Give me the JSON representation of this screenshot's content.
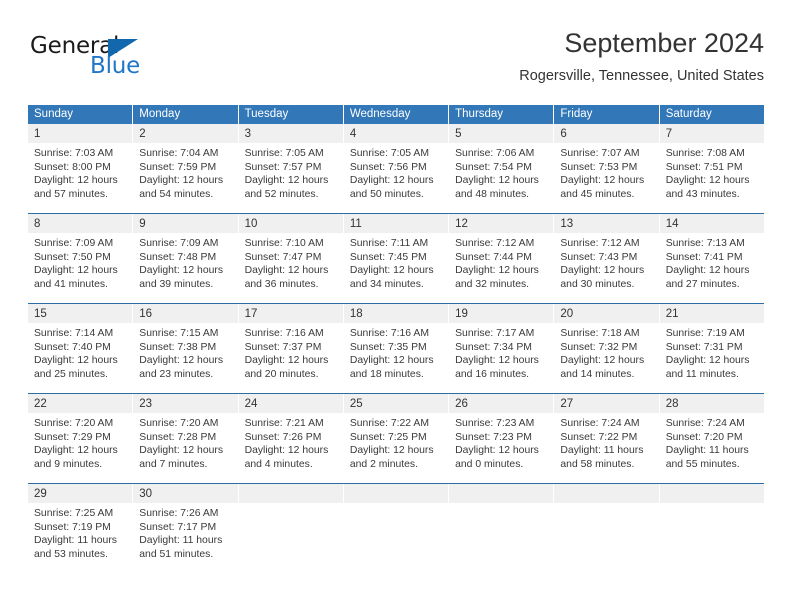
{
  "logo": {
    "word_top": "General",
    "word_bottom": "Blue",
    "accent_color": "#1267ad",
    "blue_text_color": "#2176c7"
  },
  "header": {
    "title": "September 2024",
    "subtitle": "Rogersville, Tennessee, United States",
    "header_bg_color": "#3277b8",
    "row_border_color": "#2e6da4",
    "daynum_bg_color": "#f0f0f0"
  },
  "weekdays": [
    "Sunday",
    "Monday",
    "Tuesday",
    "Wednesday",
    "Thursday",
    "Friday",
    "Saturday"
  ],
  "weeks": [
    [
      {
        "day": "1",
        "l1": "Sunrise: 7:03 AM",
        "l2": "Sunset: 8:00 PM",
        "l3": "Daylight: 12 hours",
        "l4": "and 57 minutes."
      },
      {
        "day": "2",
        "l1": "Sunrise: 7:04 AM",
        "l2": "Sunset: 7:59 PM",
        "l3": "Daylight: 12 hours",
        "l4": "and 54 minutes."
      },
      {
        "day": "3",
        "l1": "Sunrise: 7:05 AM",
        "l2": "Sunset: 7:57 PM",
        "l3": "Daylight: 12 hours",
        "l4": "and 52 minutes."
      },
      {
        "day": "4",
        "l1": "Sunrise: 7:05 AM",
        "l2": "Sunset: 7:56 PM",
        "l3": "Daylight: 12 hours",
        "l4": "and 50 minutes."
      },
      {
        "day": "5",
        "l1": "Sunrise: 7:06 AM",
        "l2": "Sunset: 7:54 PM",
        "l3": "Daylight: 12 hours",
        "l4": "and 48 minutes."
      },
      {
        "day": "6",
        "l1": "Sunrise: 7:07 AM",
        "l2": "Sunset: 7:53 PM",
        "l3": "Daylight: 12 hours",
        "l4": "and 45 minutes."
      },
      {
        "day": "7",
        "l1": "Sunrise: 7:08 AM",
        "l2": "Sunset: 7:51 PM",
        "l3": "Daylight: 12 hours",
        "l4": "and 43 minutes."
      }
    ],
    [
      {
        "day": "8",
        "l1": "Sunrise: 7:09 AM",
        "l2": "Sunset: 7:50 PM",
        "l3": "Daylight: 12 hours",
        "l4": "and 41 minutes."
      },
      {
        "day": "9",
        "l1": "Sunrise: 7:09 AM",
        "l2": "Sunset: 7:48 PM",
        "l3": "Daylight: 12 hours",
        "l4": "and 39 minutes."
      },
      {
        "day": "10",
        "l1": "Sunrise: 7:10 AM",
        "l2": "Sunset: 7:47 PM",
        "l3": "Daylight: 12 hours",
        "l4": "and 36 minutes."
      },
      {
        "day": "11",
        "l1": "Sunrise: 7:11 AM",
        "l2": "Sunset: 7:45 PM",
        "l3": "Daylight: 12 hours",
        "l4": "and 34 minutes."
      },
      {
        "day": "12",
        "l1": "Sunrise: 7:12 AM",
        "l2": "Sunset: 7:44 PM",
        "l3": "Daylight: 12 hours",
        "l4": "and 32 minutes."
      },
      {
        "day": "13",
        "l1": "Sunrise: 7:12 AM",
        "l2": "Sunset: 7:43 PM",
        "l3": "Daylight: 12 hours",
        "l4": "and 30 minutes."
      },
      {
        "day": "14",
        "l1": "Sunrise: 7:13 AM",
        "l2": "Sunset: 7:41 PM",
        "l3": "Daylight: 12 hours",
        "l4": "and 27 minutes."
      }
    ],
    [
      {
        "day": "15",
        "l1": "Sunrise: 7:14 AM",
        "l2": "Sunset: 7:40 PM",
        "l3": "Daylight: 12 hours",
        "l4": "and 25 minutes."
      },
      {
        "day": "16",
        "l1": "Sunrise: 7:15 AM",
        "l2": "Sunset: 7:38 PM",
        "l3": "Daylight: 12 hours",
        "l4": "and 23 minutes."
      },
      {
        "day": "17",
        "l1": "Sunrise: 7:16 AM",
        "l2": "Sunset: 7:37 PM",
        "l3": "Daylight: 12 hours",
        "l4": "and 20 minutes."
      },
      {
        "day": "18",
        "l1": "Sunrise: 7:16 AM",
        "l2": "Sunset: 7:35 PM",
        "l3": "Daylight: 12 hours",
        "l4": "and 18 minutes."
      },
      {
        "day": "19",
        "l1": "Sunrise: 7:17 AM",
        "l2": "Sunset: 7:34 PM",
        "l3": "Daylight: 12 hours",
        "l4": "and 16 minutes."
      },
      {
        "day": "20",
        "l1": "Sunrise: 7:18 AM",
        "l2": "Sunset: 7:32 PM",
        "l3": "Daylight: 12 hours",
        "l4": "and 14 minutes."
      },
      {
        "day": "21",
        "l1": "Sunrise: 7:19 AM",
        "l2": "Sunset: 7:31 PM",
        "l3": "Daylight: 12 hours",
        "l4": "and 11 minutes."
      }
    ],
    [
      {
        "day": "22",
        "l1": "Sunrise: 7:20 AM",
        "l2": "Sunset: 7:29 PM",
        "l3": "Daylight: 12 hours",
        "l4": "and 9 minutes."
      },
      {
        "day": "23",
        "l1": "Sunrise: 7:20 AM",
        "l2": "Sunset: 7:28 PM",
        "l3": "Daylight: 12 hours",
        "l4": "and 7 minutes."
      },
      {
        "day": "24",
        "l1": "Sunrise: 7:21 AM",
        "l2": "Sunset: 7:26 PM",
        "l3": "Daylight: 12 hours",
        "l4": "and 4 minutes."
      },
      {
        "day": "25",
        "l1": "Sunrise: 7:22 AM",
        "l2": "Sunset: 7:25 PM",
        "l3": "Daylight: 12 hours",
        "l4": "and 2 minutes."
      },
      {
        "day": "26",
        "l1": "Sunrise: 7:23 AM",
        "l2": "Sunset: 7:23 PM",
        "l3": "Daylight: 12 hours",
        "l4": "and 0 minutes."
      },
      {
        "day": "27",
        "l1": "Sunrise: 7:24 AM",
        "l2": "Sunset: 7:22 PM",
        "l3": "Daylight: 11 hours",
        "l4": "and 58 minutes."
      },
      {
        "day": "28",
        "l1": "Sunrise: 7:24 AM",
        "l2": "Sunset: 7:20 PM",
        "l3": "Daylight: 11 hours",
        "l4": "and 55 minutes."
      }
    ],
    [
      {
        "day": "29",
        "l1": "Sunrise: 7:25 AM",
        "l2": "Sunset: 7:19 PM",
        "l3": "Daylight: 11 hours",
        "l4": "and 53 minutes."
      },
      {
        "day": "30",
        "l1": "Sunrise: 7:26 AM",
        "l2": "Sunset: 7:17 PM",
        "l3": "Daylight: 11 hours",
        "l4": "and 51 minutes."
      },
      {
        "day": "",
        "l1": "",
        "l2": "",
        "l3": "",
        "l4": ""
      },
      {
        "day": "",
        "l1": "",
        "l2": "",
        "l3": "",
        "l4": ""
      },
      {
        "day": "",
        "l1": "",
        "l2": "",
        "l3": "",
        "l4": ""
      },
      {
        "day": "",
        "l1": "",
        "l2": "",
        "l3": "",
        "l4": ""
      },
      {
        "day": "",
        "l1": "",
        "l2": "",
        "l3": "",
        "l4": ""
      }
    ]
  ]
}
